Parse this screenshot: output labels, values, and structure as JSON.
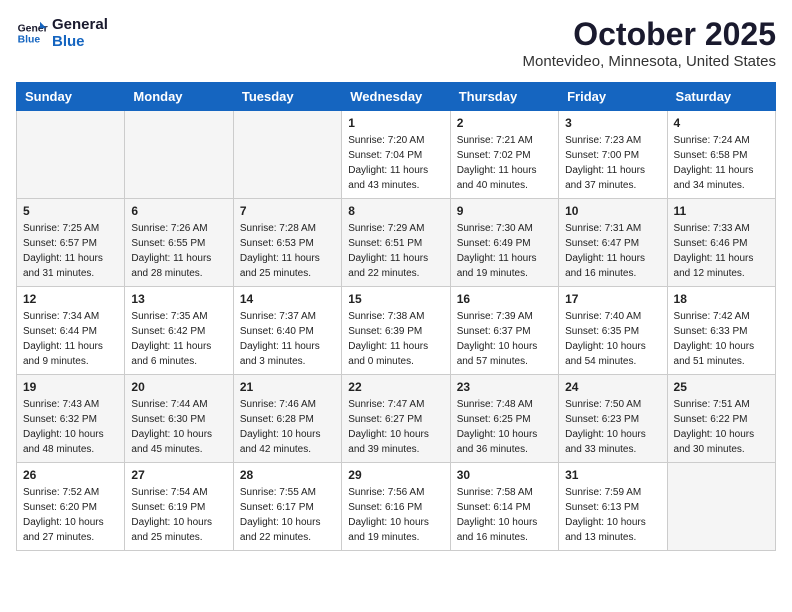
{
  "header": {
    "logo_line1": "General",
    "logo_line2": "Blue",
    "month": "October 2025",
    "location": "Montevideo, Minnesota, United States"
  },
  "weekdays": [
    "Sunday",
    "Monday",
    "Tuesday",
    "Wednesday",
    "Thursday",
    "Friday",
    "Saturday"
  ],
  "weeks": [
    [
      {
        "day": "",
        "info": ""
      },
      {
        "day": "",
        "info": ""
      },
      {
        "day": "",
        "info": ""
      },
      {
        "day": "1",
        "info": "Sunrise: 7:20 AM\nSunset: 7:04 PM\nDaylight: 11 hours\nand 43 minutes."
      },
      {
        "day": "2",
        "info": "Sunrise: 7:21 AM\nSunset: 7:02 PM\nDaylight: 11 hours\nand 40 minutes."
      },
      {
        "day": "3",
        "info": "Sunrise: 7:23 AM\nSunset: 7:00 PM\nDaylight: 11 hours\nand 37 minutes."
      },
      {
        "day": "4",
        "info": "Sunrise: 7:24 AM\nSunset: 6:58 PM\nDaylight: 11 hours\nand 34 minutes."
      }
    ],
    [
      {
        "day": "5",
        "info": "Sunrise: 7:25 AM\nSunset: 6:57 PM\nDaylight: 11 hours\nand 31 minutes."
      },
      {
        "day": "6",
        "info": "Sunrise: 7:26 AM\nSunset: 6:55 PM\nDaylight: 11 hours\nand 28 minutes."
      },
      {
        "day": "7",
        "info": "Sunrise: 7:28 AM\nSunset: 6:53 PM\nDaylight: 11 hours\nand 25 minutes."
      },
      {
        "day": "8",
        "info": "Sunrise: 7:29 AM\nSunset: 6:51 PM\nDaylight: 11 hours\nand 22 minutes."
      },
      {
        "day": "9",
        "info": "Sunrise: 7:30 AM\nSunset: 6:49 PM\nDaylight: 11 hours\nand 19 minutes."
      },
      {
        "day": "10",
        "info": "Sunrise: 7:31 AM\nSunset: 6:47 PM\nDaylight: 11 hours\nand 16 minutes."
      },
      {
        "day": "11",
        "info": "Sunrise: 7:33 AM\nSunset: 6:46 PM\nDaylight: 11 hours\nand 12 minutes."
      }
    ],
    [
      {
        "day": "12",
        "info": "Sunrise: 7:34 AM\nSunset: 6:44 PM\nDaylight: 11 hours\nand 9 minutes."
      },
      {
        "day": "13",
        "info": "Sunrise: 7:35 AM\nSunset: 6:42 PM\nDaylight: 11 hours\nand 6 minutes."
      },
      {
        "day": "14",
        "info": "Sunrise: 7:37 AM\nSunset: 6:40 PM\nDaylight: 11 hours\nand 3 minutes."
      },
      {
        "day": "15",
        "info": "Sunrise: 7:38 AM\nSunset: 6:39 PM\nDaylight: 11 hours\nand 0 minutes."
      },
      {
        "day": "16",
        "info": "Sunrise: 7:39 AM\nSunset: 6:37 PM\nDaylight: 10 hours\nand 57 minutes."
      },
      {
        "day": "17",
        "info": "Sunrise: 7:40 AM\nSunset: 6:35 PM\nDaylight: 10 hours\nand 54 minutes."
      },
      {
        "day": "18",
        "info": "Sunrise: 7:42 AM\nSunset: 6:33 PM\nDaylight: 10 hours\nand 51 minutes."
      }
    ],
    [
      {
        "day": "19",
        "info": "Sunrise: 7:43 AM\nSunset: 6:32 PM\nDaylight: 10 hours\nand 48 minutes."
      },
      {
        "day": "20",
        "info": "Sunrise: 7:44 AM\nSunset: 6:30 PM\nDaylight: 10 hours\nand 45 minutes."
      },
      {
        "day": "21",
        "info": "Sunrise: 7:46 AM\nSunset: 6:28 PM\nDaylight: 10 hours\nand 42 minutes."
      },
      {
        "day": "22",
        "info": "Sunrise: 7:47 AM\nSunset: 6:27 PM\nDaylight: 10 hours\nand 39 minutes."
      },
      {
        "day": "23",
        "info": "Sunrise: 7:48 AM\nSunset: 6:25 PM\nDaylight: 10 hours\nand 36 minutes."
      },
      {
        "day": "24",
        "info": "Sunrise: 7:50 AM\nSunset: 6:23 PM\nDaylight: 10 hours\nand 33 minutes."
      },
      {
        "day": "25",
        "info": "Sunrise: 7:51 AM\nSunset: 6:22 PM\nDaylight: 10 hours\nand 30 minutes."
      }
    ],
    [
      {
        "day": "26",
        "info": "Sunrise: 7:52 AM\nSunset: 6:20 PM\nDaylight: 10 hours\nand 27 minutes."
      },
      {
        "day": "27",
        "info": "Sunrise: 7:54 AM\nSunset: 6:19 PM\nDaylight: 10 hours\nand 25 minutes."
      },
      {
        "day": "28",
        "info": "Sunrise: 7:55 AM\nSunset: 6:17 PM\nDaylight: 10 hours\nand 22 minutes."
      },
      {
        "day": "29",
        "info": "Sunrise: 7:56 AM\nSunset: 6:16 PM\nDaylight: 10 hours\nand 19 minutes."
      },
      {
        "day": "30",
        "info": "Sunrise: 7:58 AM\nSunset: 6:14 PM\nDaylight: 10 hours\nand 16 minutes."
      },
      {
        "day": "31",
        "info": "Sunrise: 7:59 AM\nSunset: 6:13 PM\nDaylight: 10 hours\nand 13 minutes."
      },
      {
        "day": "",
        "info": ""
      }
    ]
  ]
}
